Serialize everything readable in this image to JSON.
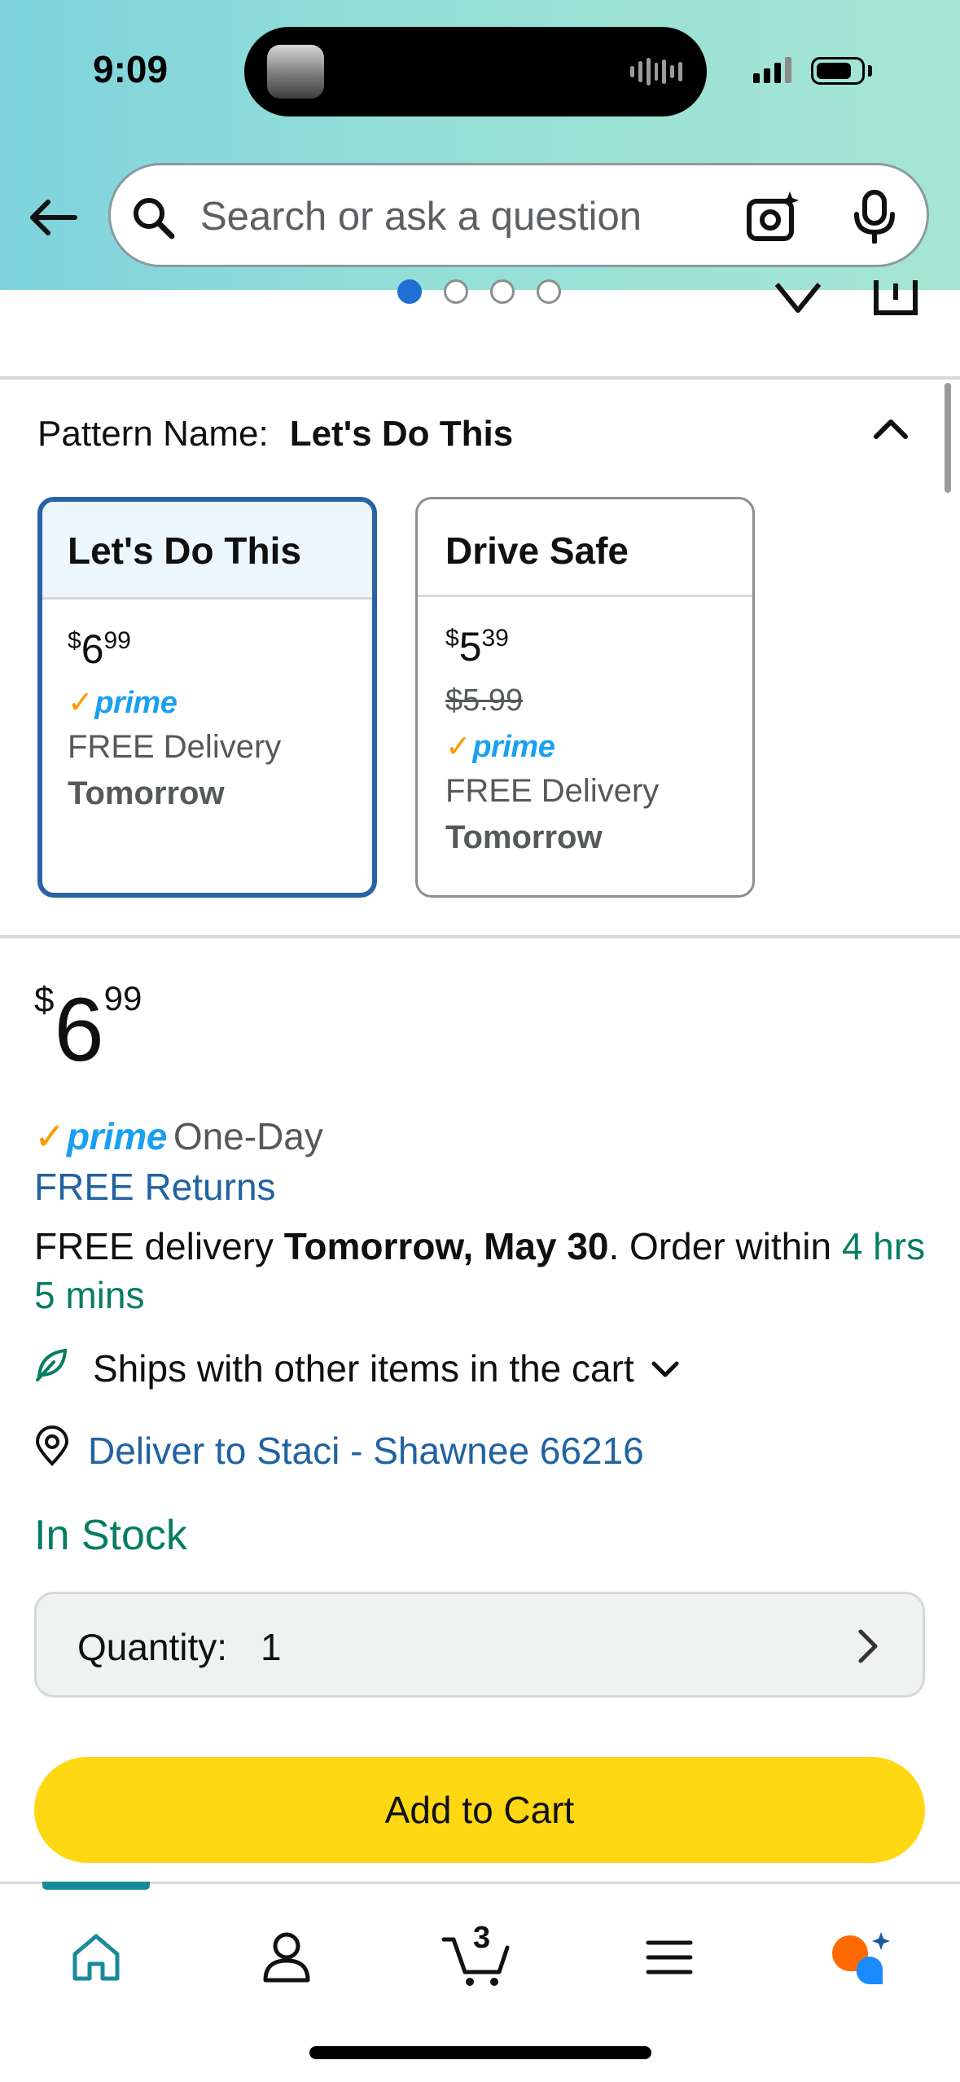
{
  "status_bar": {
    "time": "9:09"
  },
  "search": {
    "placeholder": "Search or ask a question"
  },
  "carousel": {
    "dot_count": 4,
    "active_index": 0
  },
  "pattern": {
    "label": "Pattern Name:",
    "selected": "Let's Do This",
    "options": [
      {
        "name": "Let's Do This",
        "price_symbol": "$",
        "price_whole": "6",
        "price_cents": "99",
        "list_price": "",
        "prime": "prime",
        "delivery": "FREE Delivery",
        "delivery_day": "Tomorrow",
        "selected": true
      },
      {
        "name": "Drive Safe",
        "price_symbol": "$",
        "price_whole": "5",
        "price_cents": "39",
        "list_price": "$5.99",
        "prime": "prime",
        "delivery": "FREE Delivery",
        "delivery_day": "Tomorrow",
        "selected": false
      }
    ]
  },
  "buybox": {
    "price_symbol": "$",
    "price_whole": "6",
    "price_cents": "99",
    "prime_text": "prime",
    "prime_tag": "One-Day",
    "returns": "FREE Returns",
    "delivery_prefix": "FREE delivery ",
    "delivery_date": "Tomorrow, May 30",
    "delivery_mid": ". Order within ",
    "delivery_countdown": "4 hrs 5 mins",
    "ships_with": "Ships with other items in the cart",
    "deliver_to": "Deliver to Staci - Shawnee 66216",
    "stock": "In Stock",
    "quantity_label": "Quantity:",
    "quantity_value": "1",
    "add_to_cart": "Add to Cart"
  },
  "bottom_nav": {
    "cart_count": "3",
    "items": [
      "home-icon",
      "account-icon",
      "cart-icon",
      "menu-icon",
      "rufus-icon"
    ],
    "active_color": "#1a8a9a"
  },
  "colors": {
    "accent_blue": "#2162a1",
    "in_stock_green": "#067d62",
    "add_to_cart_yellow": "#ffd814",
    "prime_blue": "#1aa0f0",
    "prime_check_orange": "#ff9900",
    "selected_border": "#2a62a6"
  }
}
